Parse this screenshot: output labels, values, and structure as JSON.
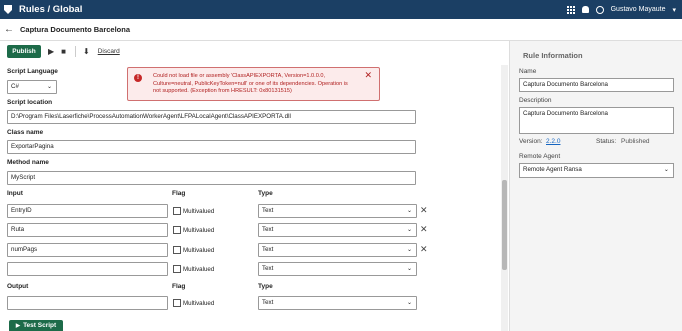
{
  "app": {
    "title": "Rules / Global",
    "user": "Gustavo Mayaute"
  },
  "page": {
    "title": "Captura Documento Barcelona"
  },
  "toolbar": {
    "publish": "Publish",
    "discard": "Discard"
  },
  "form": {
    "script_language_label": "Script Language",
    "script_language": "C#",
    "script_location_label": "Script location",
    "script_location": "D:\\Program Files\\Laserfiche\\ProcessAutomationWorkerAgent\\LFPALocalAgent\\ClassAPIEXPORTA.dll",
    "class_name_label": "Class name",
    "class_name": "ExportarPagina",
    "method_name_label": "Method name",
    "method_name": "MyScript",
    "input_label": "Input",
    "flag_label": "Flag",
    "type_label": "Type",
    "multivalued": "Multivalued",
    "inputs": [
      {
        "name": "EntryID",
        "type": "Text"
      },
      {
        "name": "Ruta",
        "type": "Text"
      },
      {
        "name": "numPags",
        "type": "Text"
      },
      {
        "name": "",
        "type": "Text"
      }
    ],
    "output_label": "Output",
    "outputs": [
      {
        "name": "",
        "type": "Text"
      }
    ],
    "test_script": "Test Script"
  },
  "error": {
    "message": "Could not load file or assembly 'ClassAPIEXPORTA, Version=1.0.0.0, Culture=neutral, PublicKeyToken=null' or one of its dependencies. Operation is not supported. (Exception from HRESULT: 0x80131515)"
  },
  "rule_info": {
    "title": "Rule Information",
    "name_label": "Name",
    "name": "Captura Documento Barcelona",
    "description_label": "Description",
    "description": "Captura Documento Barcelona",
    "version_label": "Version:",
    "version": "2.2.0",
    "status_label": "Status:",
    "status": "Published",
    "remote_agent_label": "Remote Agent",
    "remote_agent": "Remote Agent Ransa"
  },
  "colors": {
    "header": "#1b3f64",
    "publish": "#1d6b49",
    "error_bg": "#fcebeb",
    "error_text": "#b02020"
  }
}
